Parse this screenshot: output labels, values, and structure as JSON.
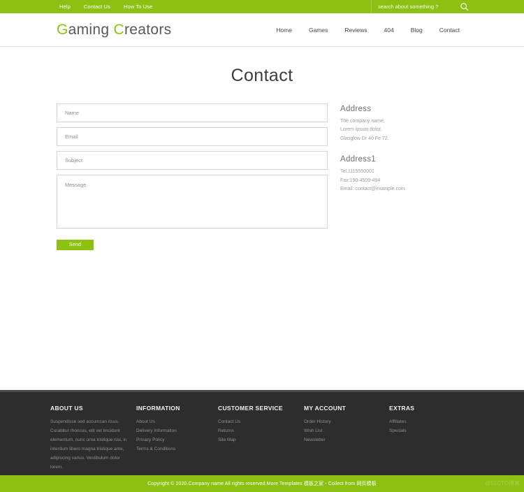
{
  "colors": {
    "accent_green": "#8cc012",
    "footer_dark": "#2d2d2d",
    "text_dark": "#3d3d3d",
    "muted_gray": "#9b9b9b"
  },
  "topbar": {
    "links": [
      {
        "label": "Help"
      },
      {
        "label": "Contact Us"
      },
      {
        "label": "How To Use"
      }
    ],
    "search": {
      "placeholder": "search about something ?",
      "value": "",
      "icon": "search-icon"
    }
  },
  "header": {
    "logo": {
      "part1_accent": "G",
      "part1_rest": "aming ",
      "part2_accent": "C",
      "part2_rest": "reators",
      "full": "Gaming Creators"
    },
    "nav": [
      {
        "label": "Home"
      },
      {
        "label": "Games"
      },
      {
        "label": "Reviews"
      },
      {
        "label": "404"
      },
      {
        "label": "Blog"
      },
      {
        "label": "Contact"
      }
    ]
  },
  "main": {
    "page_title": "Contact",
    "form": {
      "name_placeholder": "Name",
      "name_value": "",
      "email_placeholder": "Email",
      "email_value": "",
      "subject_placeholder": "Subject",
      "subject_value": "",
      "message_placeholder": "Message",
      "message_value": "",
      "send_label": "Send"
    },
    "address": {
      "title": "Address",
      "lines": [
        "The company name,",
        "Lorem ipsum dolor,",
        "Glasglow Dr 40 Fe 72."
      ]
    },
    "address1": {
      "title": "Address1",
      "lines": [
        "Tel:1115550001",
        "Fax:190-4509-494",
        "Email: contact@example.com"
      ]
    }
  },
  "footer": {
    "about": {
      "title": "ABOUT US",
      "text": "Suspendisse sed accumsan risus. Curabitur rhoncus, elit vel tincidunt elementum, nunc urna tristique nisi, in interdum libero magna tristique ante, adipiscing varius. Vestibulum dolor lorem."
    },
    "information": {
      "title": "INFORMATION",
      "links": [
        {
          "label": "About Us"
        },
        {
          "label": "Delivery Information"
        },
        {
          "label": "Privacy Policy"
        },
        {
          "label": "Terms & Conditions"
        }
      ]
    },
    "customer_service": {
      "title": "CUSTOMER SERVICE",
      "links": [
        {
          "label": "Contact Us"
        },
        {
          "label": "Returns"
        },
        {
          "label": "Site Map"
        }
      ]
    },
    "my_account": {
      "title": "MY ACCOUNT",
      "links": [
        {
          "label": "Order History"
        },
        {
          "label": "Wish List"
        },
        {
          "label": "Newsletter"
        }
      ]
    },
    "extras": {
      "title": "EXTRAS",
      "links": [
        {
          "label": "Affiliates"
        },
        {
          "label": "Specials"
        }
      ]
    }
  },
  "copyright": {
    "text": "Copyright © 2020.Company name All rights reserved.More Templates 模板之家 - Collect from 网页模板",
    "watermark": "@51CTO博客"
  }
}
